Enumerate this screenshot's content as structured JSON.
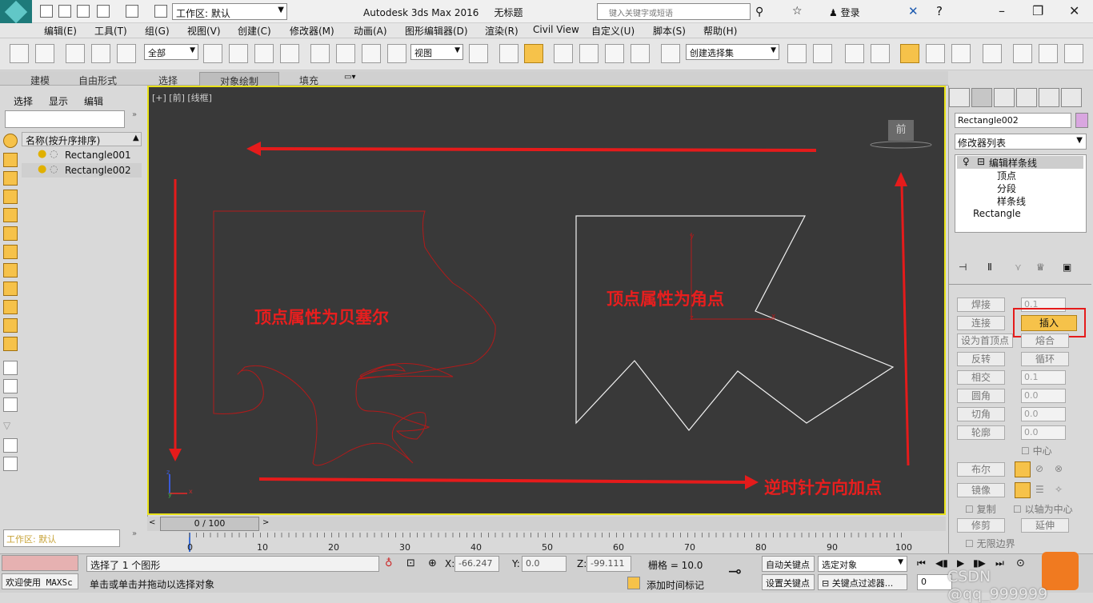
{
  "title_bar": {
    "logo": "MAX",
    "workspace": "工作区: 默认",
    "app_title": "Autodesk 3ds Max 2016",
    "doc_title": "无标题",
    "search_placeholder": "键入关键字或短语",
    "login": "登录"
  },
  "menu": [
    "编辑(E)",
    "工具(T)",
    "组(G)",
    "视图(V)",
    "创建(C)",
    "修改器(M)",
    "动画(A)",
    "图形编辑器(D)",
    "渲染(R)",
    "Civil View",
    "自定义(U)",
    "脚本(S)",
    "帮助(H)"
  ],
  "toolbar": {
    "selection_filter": "全部",
    "ref_coord": "视图",
    "named_selection": "创建选择集"
  },
  "ribbon_tabs": [
    "建模",
    "自由形式",
    "选择",
    "对象绘制",
    "填充"
  ],
  "scene_explorer": {
    "tabs": [
      "选择",
      "显示",
      "编辑"
    ],
    "header": "名称(按升序排序)",
    "items": [
      "Rectangle001",
      "Rectangle002"
    ],
    "layer": "工作区: 默认"
  },
  "viewport": {
    "label": "[+] [前] [线框]",
    "viewcube": "前"
  },
  "annotations": {
    "bezier": "顶点属性为贝塞尔",
    "corner": "顶点属性为角点",
    "ccw": "逆时针方向加点"
  },
  "command_panel": {
    "object_name": "Rectangle002",
    "modifier_list": "修改器列表",
    "stack": {
      "head": "编辑样条线",
      "subs": [
        "顶点",
        "分段",
        "样条线"
      ],
      "base": "Rectangle"
    },
    "buttons": {
      "weld": "焊接",
      "connect": "连接",
      "first_vertex": "设为首顶点",
      "reverse": "反转",
      "intersect": "相交",
      "fillet": "圆角",
      "chamfer": "切角",
      "outline": "轮廓",
      "insert": "插入",
      "fuse": "熔合",
      "cycle": "循环",
      "center": "中心",
      "boolean": "布尔",
      "mirror": "镜像",
      "copy": "复制",
      "about_pivot": "以轴为中心",
      "trim": "修剪",
      "extend": "延伸",
      "infinite_bounds": "无限边界"
    },
    "spinners": {
      "weld": "0.1",
      "intersect": "0.1",
      "fillet": "0.0",
      "chamfer": "0.0",
      "outline": "0.0"
    }
  },
  "time_slider": {
    "frame": "0 / 100",
    "ticks": [
      "0",
      "10",
      "20",
      "30",
      "40",
      "50",
      "60",
      "70",
      "80",
      "90",
      "100"
    ]
  },
  "status": {
    "selected": "选择了 1 个图形",
    "prompt": "单击或单击并拖动以选择对象",
    "welcome": "欢迎使用 MAXSc",
    "x": "-66.247",
    "y": "0.0",
    "z": "-99.111",
    "grid": "栅格 = 10.0",
    "add_time_tag": "添加时间标记",
    "auto_key": "自动关键点",
    "set_key": "设置关键点",
    "selected_object": "选定对象",
    "key_filter": "关键点过滤器...",
    "frame_field": "0",
    "watermark": "CSDN @qq_999999"
  }
}
